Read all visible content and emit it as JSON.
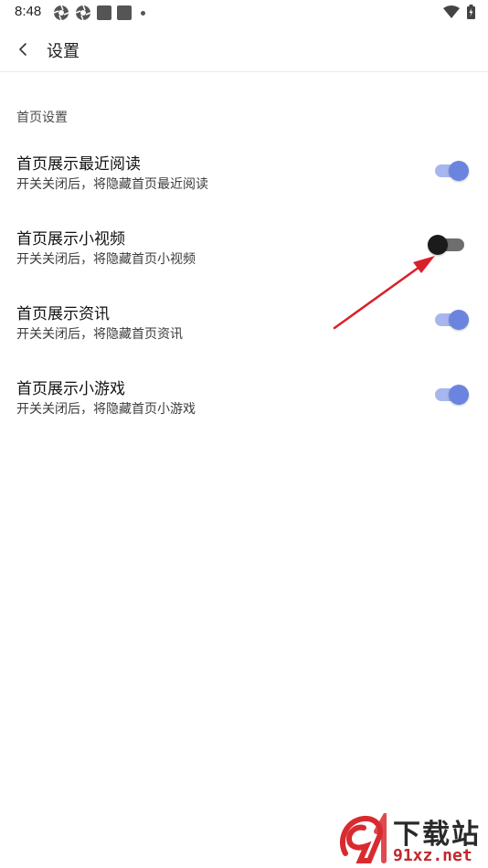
{
  "status_bar": {
    "time": "8:48"
  },
  "app_bar": {
    "title": "设置"
  },
  "section": {
    "title": "首页设置"
  },
  "settings": [
    {
      "title": "首页展示最近阅读",
      "desc": "开关关闭后，将隐藏首页最近阅读",
      "enabled": true
    },
    {
      "title": "首页展示小视频",
      "desc": "开关关闭后，将隐藏首页小视频",
      "enabled": false
    },
    {
      "title": "首页展示资讯",
      "desc": "开关关闭后，将隐藏首页资讯",
      "enabled": true
    },
    {
      "title": "首页展示小游戏",
      "desc": "开关关闭后，将隐藏首页小游戏",
      "enabled": true
    }
  ],
  "watermark": {
    "top": "下载站",
    "bottom": "91xz.net"
  },
  "colors": {
    "toggle_on_thumb": "#6b84e0",
    "toggle_on_track": "#a8b6ee",
    "toggle_off_thumb": "#1b1b1b",
    "toggle_off_track": "#6e6e6e",
    "annotation_arrow": "#d9202a"
  }
}
